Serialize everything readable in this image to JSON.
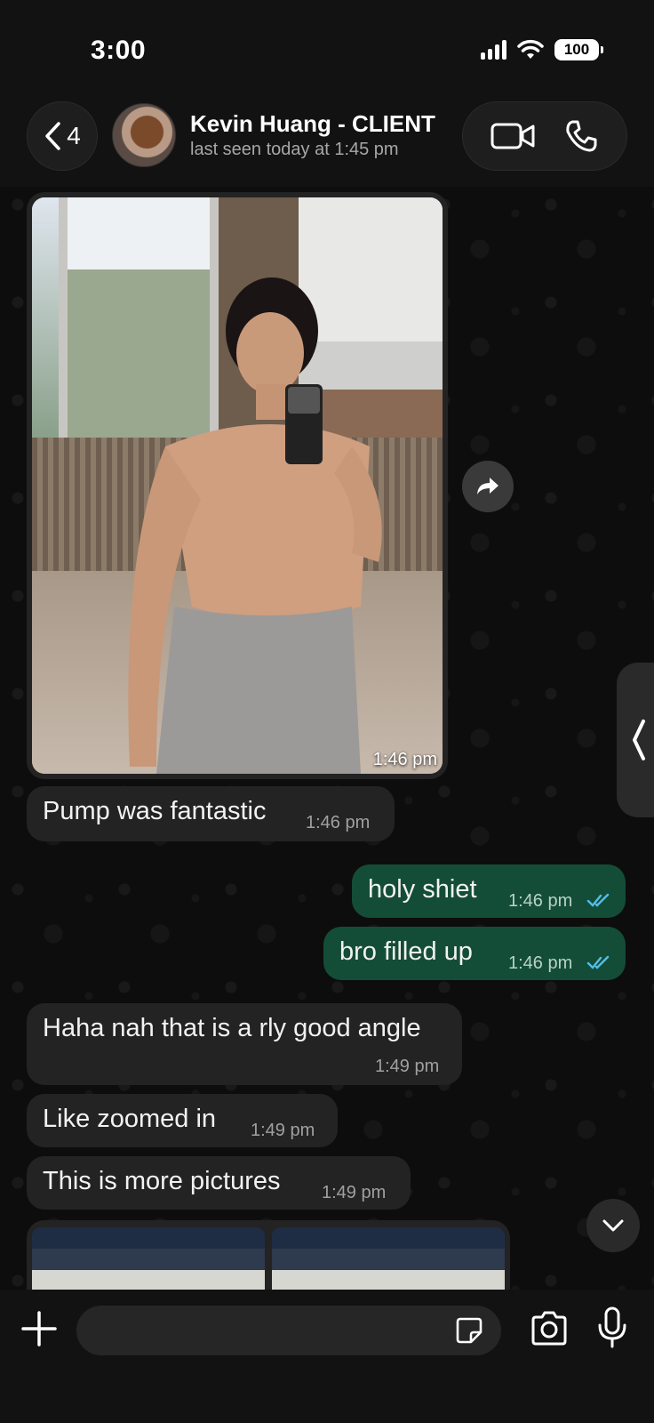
{
  "status_bar": {
    "time": "3:00",
    "battery": "100"
  },
  "header": {
    "back_count": "4",
    "contact_name": "Kevin Huang - CLIENT",
    "last_seen": "last seen today at 1:45 pm"
  },
  "messages": [
    {
      "id": "photo1",
      "direction": "in",
      "type": "image",
      "time": "1:46 pm"
    },
    {
      "id": "m1",
      "direction": "in",
      "text": "Pump was fantastic",
      "time": "1:46 pm"
    },
    {
      "id": "m2",
      "direction": "out",
      "text": "holy shiet",
      "time": "1:46 pm",
      "read": true
    },
    {
      "id": "m3",
      "direction": "out",
      "text": "bro filled up",
      "time": "1:46 pm",
      "read": true
    },
    {
      "id": "m4",
      "direction": "in",
      "text": "Haha nah that is a rly good angle",
      "time": "1:49 pm"
    },
    {
      "id": "m5",
      "direction": "in",
      "text": "Like zoomed in",
      "time": "1:49 pm"
    },
    {
      "id": "m6",
      "direction": "in",
      "text": "This is more pictures",
      "time": "1:49 pm"
    }
  ],
  "colors": {
    "incoming_bubble": "#232323",
    "outgoing_bubble": "#144d37",
    "read_ticks": "#53bdeb",
    "background": "#0d0d0d"
  },
  "icons": [
    "back-chevron-icon",
    "video-call-icon",
    "voice-call-icon",
    "forward-icon",
    "plus-icon",
    "sticker-icon",
    "camera-icon",
    "microphone-icon",
    "chevron-down-icon",
    "chevron-left-icon"
  ]
}
